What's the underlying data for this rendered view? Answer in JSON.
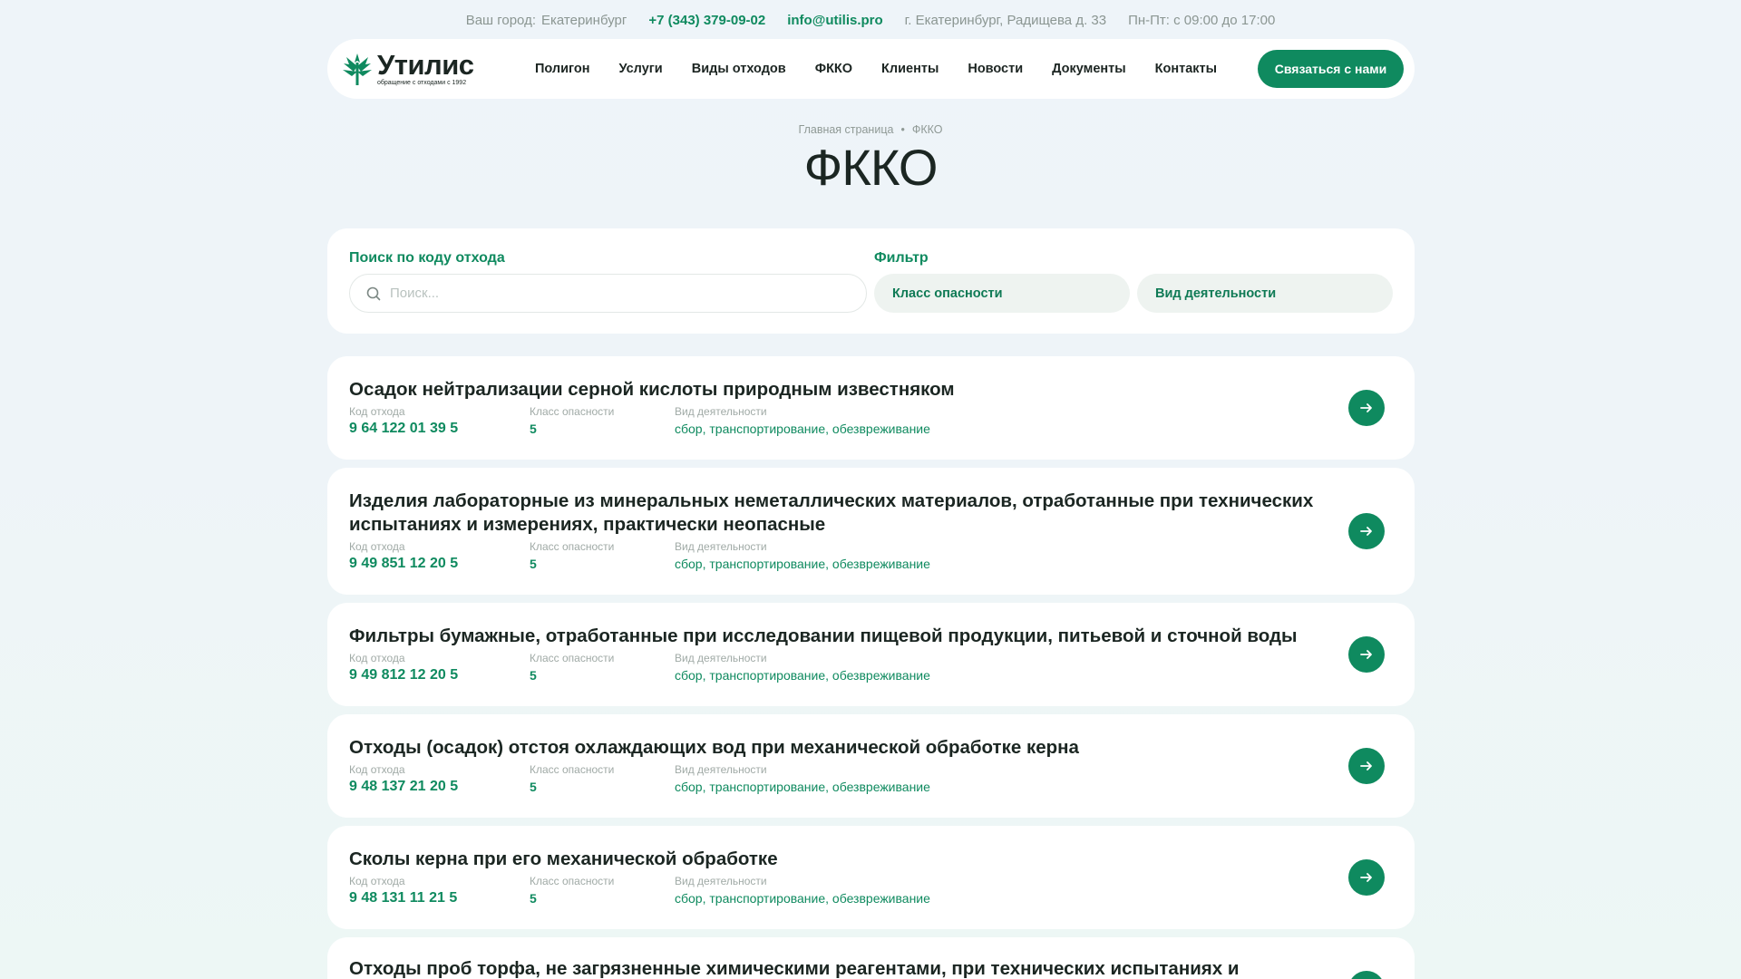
{
  "topbar": {
    "city_label": "Ваш город:",
    "city": "Екатеринбург",
    "phone": "+7 (343) 379-09-02",
    "email": "info@utilis.pro",
    "address": "г. Екатеринбург, Радищева д. 33",
    "hours": "Пн-Пт: с 09:00 до 17:00"
  },
  "header": {
    "logo_name": "Утилис",
    "logo_sub": "обращение с отходами с 1992",
    "nav": [
      "Полигон",
      "Услуги",
      "Виды отходов",
      "ФККО",
      "Клиенты",
      "Новости",
      "Документы",
      "Контакты"
    ],
    "cta": "Связаться с нами"
  },
  "breadcrumb": {
    "home": "Главная страница",
    "current": "ФККО"
  },
  "page_title": "ФККО",
  "search": {
    "label": "Поиск по коду отхода",
    "placeholder": "Поиск...",
    "filter_label": "Фильтр",
    "filter_class": "Класс опасности",
    "filter_activity": "Вид деятельности"
  },
  "labels": {
    "code": "Код отхода",
    "class": "Класс опасности",
    "activity": "Вид деятельности"
  },
  "items": [
    {
      "title": "Осадок нейтрализации серной кислоты природным известняком",
      "code": "9 64 122 01 39 5",
      "class": "5",
      "activity": "сбор, транспортирование, обезвреживание"
    },
    {
      "title": "Изделия лабораторные из минеральных неметаллических материалов, отработанные при технических испытаниях и измерениях, практически неопасные",
      "code": "9 49 851 12 20 5",
      "class": "5",
      "activity": "сбор, транспортирование, обезвреживание"
    },
    {
      "title": "Фильтры бумажные, отработанные при исследовании пищевой продукции, питьевой и сточной воды",
      "code": "9 49 812 12 20 5",
      "class": "5",
      "activity": "сбор, транспортирование, обезвреживание"
    },
    {
      "title": "Отходы (осадок) отстоя охлаждающих вод при механической обработке керна",
      "code": "9 48 137 21 20 5",
      "class": "5",
      "activity": "сбор, транспортирование, обезвреживание"
    },
    {
      "title": "Сколы керна при его механической обработке",
      "code": "9 48 131 11 21 5",
      "class": "5",
      "activity": "сбор, транспортирование, обезвреживание"
    },
    {
      "title": "Отходы проб торфа, не загрязненные химическими реагентами, при технических испытаниях и измерениях"
    }
  ]
}
